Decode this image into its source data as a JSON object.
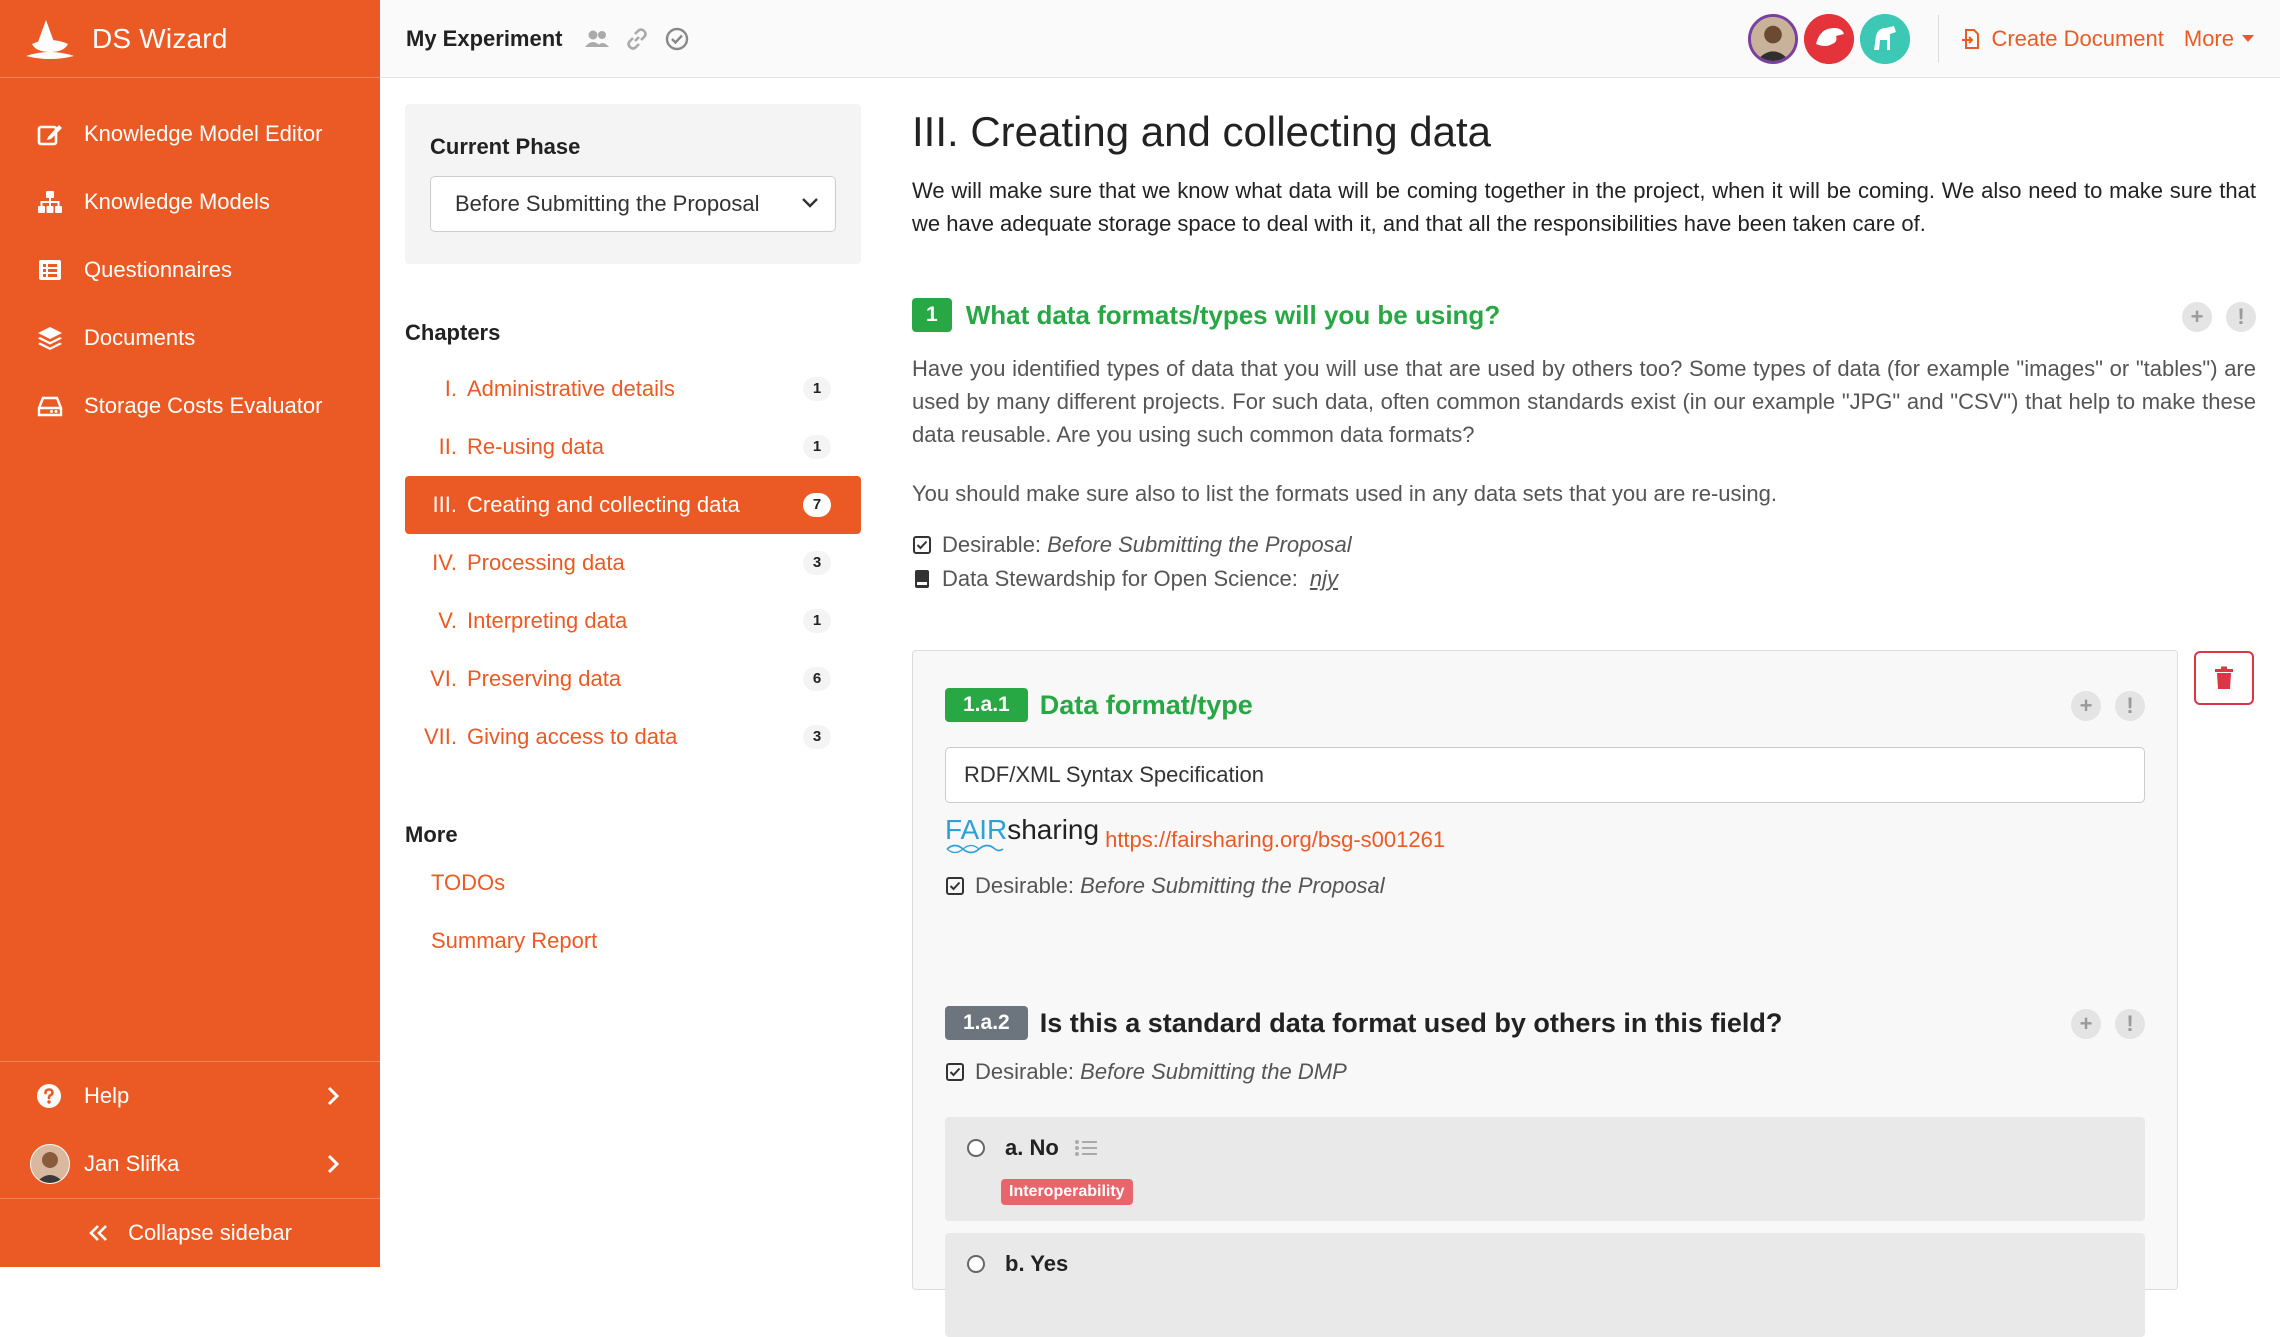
{
  "app": {
    "name": "DS Wizard"
  },
  "sidebar": {
    "items": [
      {
        "label": "Knowledge Model Editor",
        "icon": "edit-icon"
      },
      {
        "label": "Knowledge Models",
        "icon": "sitemap-icon"
      },
      {
        "label": "Questionnaires",
        "icon": "list-icon"
      },
      {
        "label": "Documents",
        "icon": "layers-icon"
      },
      {
        "label": "Storage Costs Evaluator",
        "icon": "hdd-icon"
      }
    ],
    "help": "Help",
    "user": "Jan Slifka",
    "collapse": "Collapse sidebar"
  },
  "topbar": {
    "title": "My Experiment",
    "create_document": "Create Document",
    "more": "More"
  },
  "phase": {
    "label": "Current Phase",
    "selected": "Before Submitting the Proposal"
  },
  "chapters": {
    "heading": "Chapters",
    "items": [
      {
        "num": "I.",
        "label": "Administrative details",
        "count": "1"
      },
      {
        "num": "II.",
        "label": "Re-using data",
        "count": "1"
      },
      {
        "num": "III.",
        "label": "Creating and collecting data",
        "count": "7"
      },
      {
        "num": "IV.",
        "label": "Processing data",
        "count": "3"
      },
      {
        "num": "V.",
        "label": "Interpreting data",
        "count": "1"
      },
      {
        "num": "VI.",
        "label": "Preserving data",
        "count": "6"
      },
      {
        "num": "VII.",
        "label": "Giving access to data",
        "count": "3"
      }
    ]
  },
  "more_section": {
    "heading": "More",
    "todos": "TODOs",
    "summary": "Summary Report"
  },
  "content": {
    "title": "III. Creating and collecting data",
    "description": "We will make sure that we know what data will be coming together in the project, when it will be coming. We also need to make sure that we have adequate storage space to deal with it, and that all the responsibilities have been taken care of.",
    "question": {
      "number": "1",
      "title": "What data formats/types will you be using?",
      "text": "Have you identified types of data that you will use that are used by others too? Some types of data (for example \"images\" or \"tables\") are used by many different projects. For such data, often common standards exist (in our example \"JPG\" and \"CSV\") that help to make these data reusable. Are you using such common data formats?",
      "text2": "You should make sure also to list the formats used in any data sets that you are re-using.",
      "desirable_label": "Desirable:",
      "desirable_value": "Before Submitting the Proposal",
      "book_label": "Data Stewardship for Open Science:",
      "book_ref": "njy"
    },
    "sub1": {
      "number": "1.a.1",
      "title": "Data format/type",
      "value": "RDF/XML Syntax Specification",
      "fair_a": "FAIR",
      "fair_b": "sharing",
      "link": "https://fairsharing.org/bsg-s001261",
      "desirable_label": "Desirable:",
      "desirable_value": "Before Submitting the Proposal"
    },
    "sub2": {
      "number": "1.a.2",
      "title": "Is this a standard data format used by others in this field?",
      "desirable_label": "Desirable:",
      "desirable_value": "Before Submitting the DMP",
      "options": [
        {
          "label": "a. No",
          "tag": "Interoperability"
        },
        {
          "label": "b. Yes"
        }
      ]
    }
  },
  "colors": {
    "brand": "#eb5a24",
    "green": "#28a745",
    "danger": "#dc3545",
    "gray": "#6c757d"
  }
}
